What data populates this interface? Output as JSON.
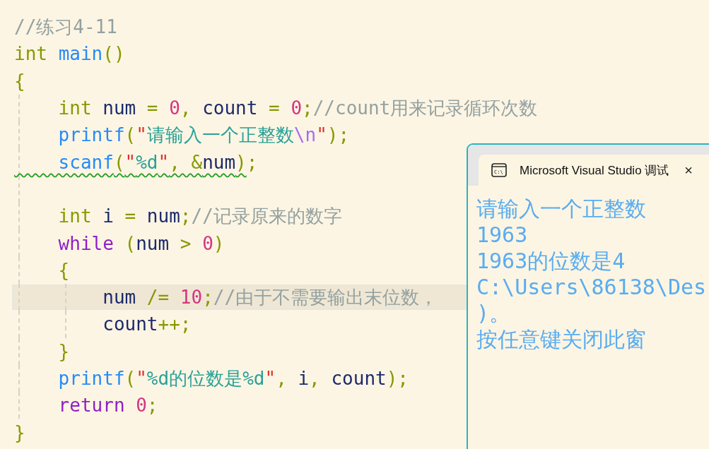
{
  "editor": {
    "lines": [
      {
        "current": false,
        "warning": false,
        "tokens": [
          {
            "t": "//练习4-11",
            "kind": "comment"
          }
        ]
      },
      {
        "current": false,
        "warning": false,
        "tokens": [
          {
            "t": "int ",
            "kind": "type"
          },
          {
            "t": "main",
            "kind": "func"
          },
          {
            "t": "()",
            "kind": "punct"
          }
        ]
      },
      {
        "current": false,
        "warning": false,
        "tokens": [
          {
            "t": "{",
            "kind": "punct"
          }
        ]
      },
      {
        "current": false,
        "warning": false,
        "tokens": [
          {
            "t": "    int",
            "kind": "type"
          },
          {
            "t": " num ",
            "kind": "ident"
          },
          {
            "t": "= ",
            "kind": "punct"
          },
          {
            "t": "0",
            "kind": "number"
          },
          {
            "t": ",",
            "kind": "punct"
          },
          {
            "t": " count ",
            "kind": "ident"
          },
          {
            "t": "= ",
            "kind": "punct"
          },
          {
            "t": "0",
            "kind": "number"
          },
          {
            "t": ";",
            "kind": "punct"
          },
          {
            "t": "//count用来记录循环次数",
            "kind": "comment"
          }
        ]
      },
      {
        "current": false,
        "warning": false,
        "tokens": [
          {
            "t": "    printf",
            "kind": "func"
          },
          {
            "t": "(",
            "kind": "punct"
          },
          {
            "t": "\"",
            "kind": "quote"
          },
          {
            "t": "请输入一个正整数",
            "kind": "string"
          },
          {
            "t": "\\n",
            "kind": "escape"
          },
          {
            "t": "\"",
            "kind": "quote"
          },
          {
            "t": ");",
            "kind": "punct"
          }
        ]
      },
      {
        "current": false,
        "warning": true,
        "tokens": [
          {
            "t": "    scanf",
            "kind": "func"
          },
          {
            "t": "(",
            "kind": "punct"
          },
          {
            "t": "\"",
            "kind": "quote"
          },
          {
            "t": "%d",
            "kind": "string"
          },
          {
            "t": "\"",
            "kind": "quote"
          },
          {
            "t": ", &",
            "kind": "punct"
          },
          {
            "t": "num",
            "kind": "ident"
          },
          {
            "t": ")",
            "kind": "punct"
          },
          {
            "t": ";",
            "kind": "punct"
          }
        ]
      },
      {
        "current": false,
        "warning": false
      },
      {
        "current": false,
        "warning": false,
        "tokens": [
          {
            "t": "    int",
            "kind": "type"
          },
          {
            "t": " i ",
            "kind": "ident"
          },
          {
            "t": "=",
            "kind": "punct"
          },
          {
            "t": " num",
            "kind": "ident"
          },
          {
            "t": ";",
            "kind": "punct"
          },
          {
            "t": "//记录原来的数字",
            "kind": "comment"
          }
        ]
      },
      {
        "current": false,
        "warning": false,
        "tokens": [
          {
            "t": "    while",
            "kind": "keyword"
          },
          {
            "t": " (",
            "kind": "punct"
          },
          {
            "t": "num ",
            "kind": "ident"
          },
          {
            "t": "> ",
            "kind": "punct"
          },
          {
            "t": "0",
            "kind": "number"
          },
          {
            "t": ")",
            "kind": "punct"
          }
        ]
      },
      {
        "current": false,
        "warning": false,
        "tokens": [
          {
            "t": "    {",
            "kind": "punct"
          }
        ]
      },
      {
        "current": true,
        "warning": false,
        "tokens": [
          {
            "t": "        num ",
            "kind": "ident"
          },
          {
            "t": "/= ",
            "kind": "punct"
          },
          {
            "t": "10",
            "kind": "number"
          },
          {
            "t": ";",
            "kind": "punct"
          },
          {
            "t": "//由于不需要输出末位数，",
            "kind": "comment"
          }
        ]
      },
      {
        "current": false,
        "warning": false,
        "tokens": [
          {
            "t": "        count",
            "kind": "ident"
          },
          {
            "t": "++;",
            "kind": "punct"
          }
        ]
      },
      {
        "current": false,
        "warning": false,
        "tokens": [
          {
            "t": "    }",
            "kind": "punct"
          }
        ]
      },
      {
        "current": false,
        "warning": false,
        "tokens": [
          {
            "t": "    printf",
            "kind": "func"
          },
          {
            "t": "(",
            "kind": "punct"
          },
          {
            "t": "\"",
            "kind": "quote"
          },
          {
            "t": "%d的位数是%d",
            "kind": "string"
          },
          {
            "t": "\"",
            "kind": "quote"
          },
          {
            "t": ", ",
            "kind": "punct"
          },
          {
            "t": "i",
            "kind": "ident"
          },
          {
            "t": ", ",
            "kind": "punct"
          },
          {
            "t": "count",
            "kind": "ident"
          },
          {
            "t": ");",
            "kind": "punct"
          }
        ]
      },
      {
        "current": false,
        "warning": false,
        "tokens": [
          {
            "t": "    return ",
            "kind": "keyword"
          },
          {
            "t": "0",
            "kind": "number"
          },
          {
            "t": ";",
            "kind": "punct"
          }
        ]
      },
      {
        "current": false,
        "warning": false,
        "tokens": [
          {
            "t": "}",
            "kind": "punct"
          }
        ]
      }
    ]
  },
  "console": {
    "icon_text": "C:\\",
    "title": "Microsoft Visual Studio 调试",
    "close": "×",
    "lines": [
      "请输入一个正整数",
      "1963",
      "1963的位数是4",
      "C:\\Users\\86138\\Des",
      ")。",
      "按任意键关闭此窗"
    ]
  }
}
